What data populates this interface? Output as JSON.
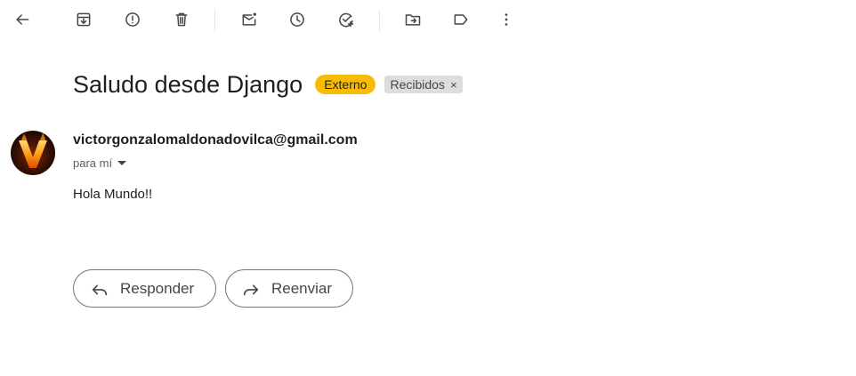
{
  "toolbar": {
    "icons": [
      "back-arrow-icon",
      "archive-icon",
      "report-spam-icon",
      "delete-icon",
      "mark-unread-icon",
      "snooze-icon",
      "add-task-icon",
      "move-to-icon",
      "label-icon",
      "more-options-icon"
    ]
  },
  "email": {
    "subject": "Saludo desde Django",
    "labels": {
      "external": "Externo",
      "inbox": "Recibidos",
      "inbox_remove": "×"
    },
    "sender": "victorgonzalomaldonadovilca@gmail.com",
    "recipient": "para mí",
    "body": "Hola Mundo!!"
  },
  "actions": {
    "reply_label": "Responder",
    "forward_label": "Reenviar"
  },
  "colors": {
    "external_label": "#f9bc05",
    "inbox_label": "#dddddd"
  }
}
